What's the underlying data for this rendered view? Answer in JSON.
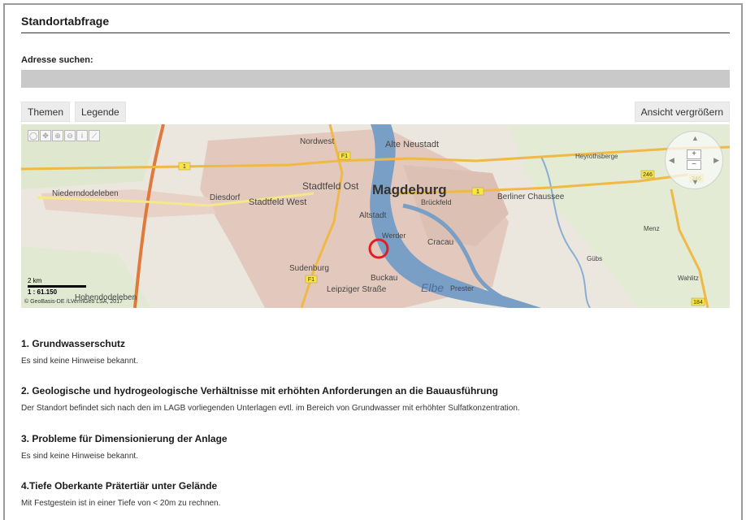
{
  "header": {
    "title": "Standortabfrage"
  },
  "search": {
    "label": "Adresse suchen:",
    "value": "",
    "placeholder": ""
  },
  "toolbar": {
    "themen": "Themen",
    "legende": "Legende",
    "enlarge": "Ansicht vergrößern"
  },
  "map": {
    "places": {
      "nordwest": "Nordwest",
      "alte_neustadt": "Alte Neustadt",
      "stadtfeld_ost": "Stadtfeld Ost",
      "magdeburg": "Magdeburg",
      "brueckfeld": "Brückfeld",
      "berliner_chaussee": "Berliner Chaussee",
      "niederndodeleben": "Niederndodeleben",
      "diesdorf": "Diesdorf",
      "stadtfeld_west": "Stadtfeld West",
      "altstadt": "Altstadt",
      "werder": "Werder",
      "cracau": "Cracau",
      "sudenburg": "Sudenburg",
      "buckau": "Buckau",
      "leipziger_strasse": "Leipziger Straße",
      "elbe": "Elbe",
      "prester": "Prester",
      "hohendodeleben": "Hohendodeleben",
      "heyrothsberge": "Heyrothsberge",
      "menz": "Menz",
      "gubs": "Gübs",
      "wahlitz": "Wahlitz"
    },
    "road_shields": {
      "b1_west": "1",
      "f1_north": "F1",
      "f1_east": "1",
      "f1_south": "F1",
      "b246a": "246",
      "b246": "246",
      "b184": "184"
    },
    "scale": {
      "distance": "2 km",
      "ratio": "1 : 61.150"
    },
    "copyright": "© GeoBasis-DE /LVermGeo LSA, 2017",
    "colors": {
      "river": "#7a9fc6",
      "urban": "#e0c4b8",
      "motorway": "#e07a3c",
      "federal_road": "#f0b845",
      "marker": "#e02020"
    }
  },
  "sections": [
    {
      "heading": "1. Grundwasserschutz",
      "text": "Es sind keine Hinweise bekannt."
    },
    {
      "heading": "2. Geologische und hydrogeologische Verhältnisse mit erhöhten Anforderungen an die Bauausführung",
      "text": "Der Standort befindet sich nach den im LAGB vorliegenden Unterlagen evtl. im Bereich von Grundwasser mit erhöhter Sulfatkonzentration."
    },
    {
      "heading": "3. Probleme für Dimensionierung der Anlage",
      "text": "Es sind keine Hinweise bekannt."
    },
    {
      "heading": "4.Tiefe Oberkante Prätertiär unter Gelände",
      "text": "Mit Festgestein ist in einer Tiefe von < 20m zu rechnen."
    }
  ]
}
